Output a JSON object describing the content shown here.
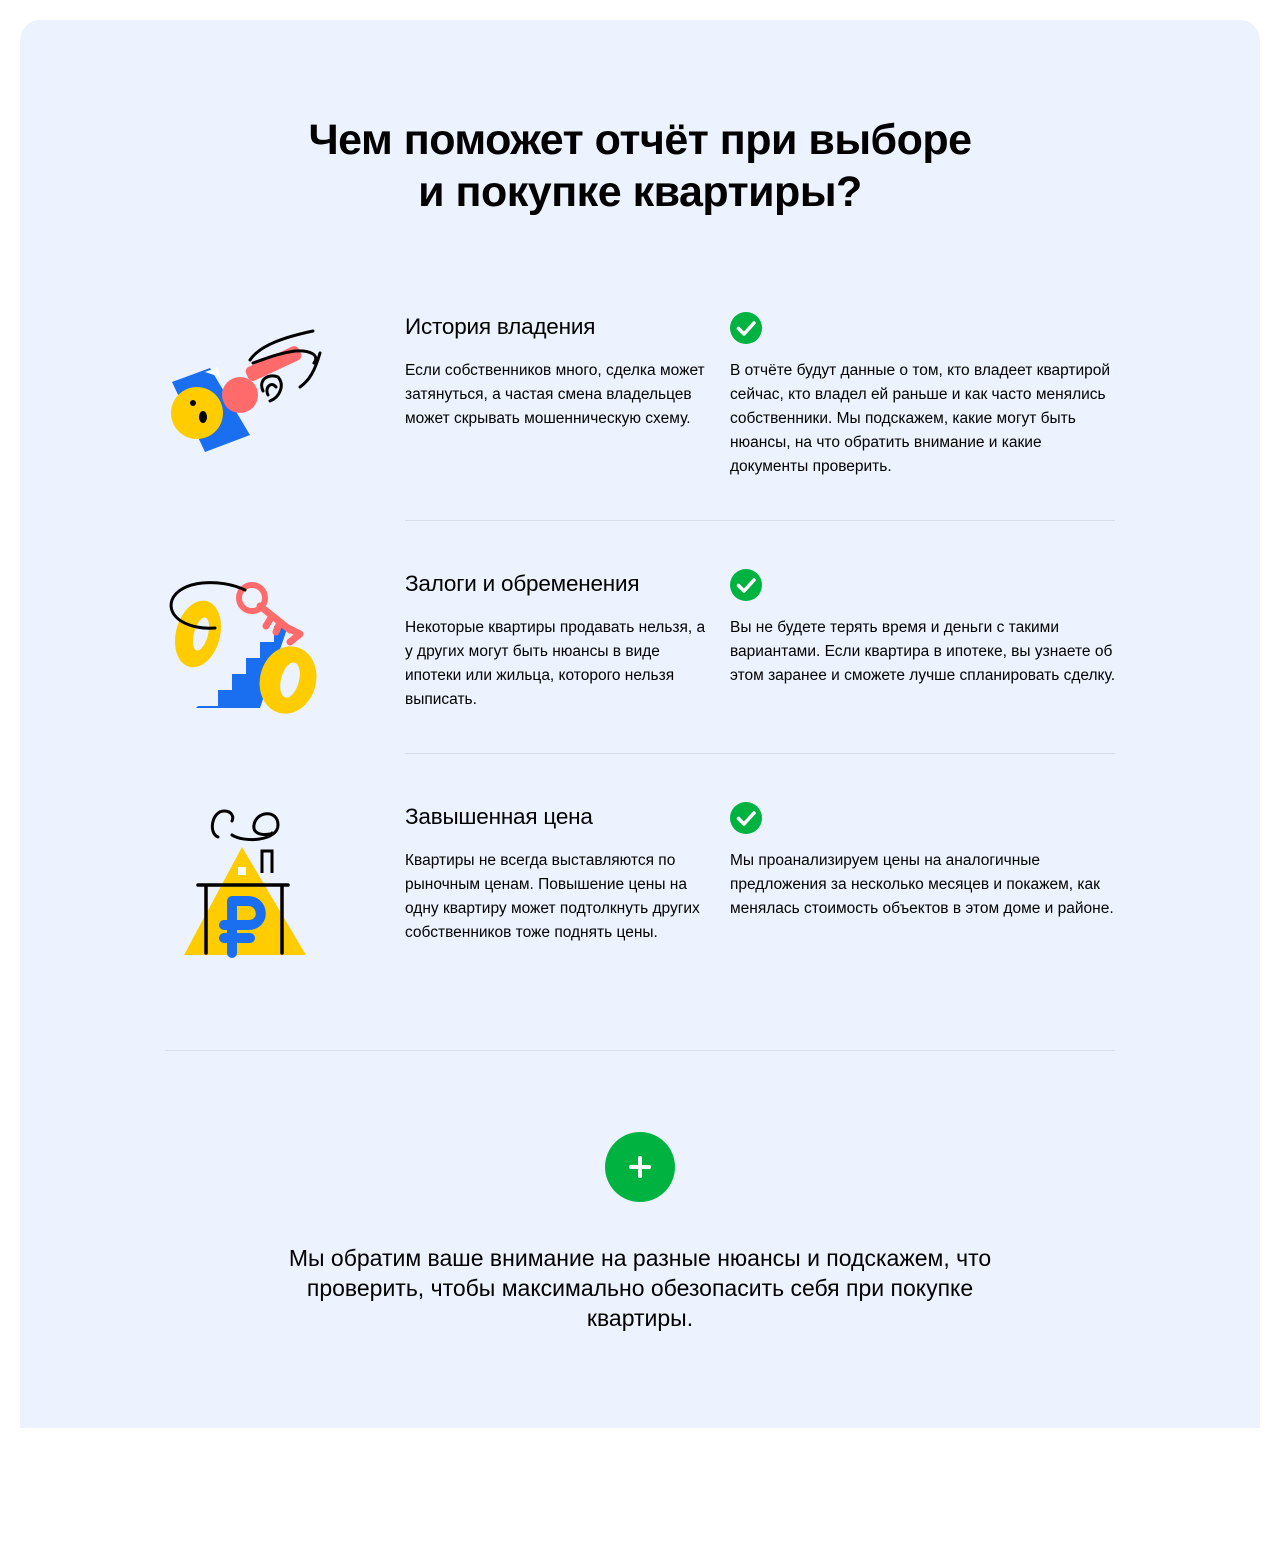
{
  "title": {
    "line1": "Чем поможет отчёт при выборе",
    "line2": "и покупке квартиры?"
  },
  "rows": [
    {
      "title": "История владения",
      "illustration_icon": "hand-with-key-icon",
      "problem": "Если собственников много, сделка может затянуться, а частая смена владельцев может скрывать мошенническую схему.",
      "solution": "В отчёте будут данные о том, кто владеет квартирой сейчас, кто владел ей раньше и как часто менялись собственники. Мы подскажем, какие могут быть нюансы, на что обратить внимание и какие документы проверить."
    },
    {
      "title": "Залоги и обременения",
      "illustration_icon": "percent-with-key-icon",
      "problem": "Некоторые квартиры продавать нельзя, а у других могут быть нюансы в виде ипотеки или жильца, которого нельзя выписать.",
      "solution": "Вы не будете терять время и деньги с такими вариантами. Если квартира в ипотеке, вы узнаете об этом заранее и сможете лучше спланировать сделку."
    },
    {
      "title": "Завышенная цена",
      "illustration_icon": "house-with-ruble-icon",
      "problem": "Квартиры не всегда выставляются по рыночным ценам. Повышение цены на одну квартиру может подтолкнуть других собственников тоже поднять цены.",
      "solution": "Мы проанализируем цены на аналогичные предложения за несколько месяцев и покажем, как менялась стоимость объектов в этом доме и районе."
    }
  ],
  "summary": "Мы обратим ваше внимание на разные нюансы и подскажем, что проверить, чтобы максимально обезопасить себя при покупке квартиры.",
  "colors": {
    "panel_background": "#ecf3fe",
    "accent_green": "#00b341",
    "illustration_blue": "#1a6ef0",
    "illustration_yellow": "#ffcc00",
    "illustration_coral": "#ff6b6b"
  }
}
